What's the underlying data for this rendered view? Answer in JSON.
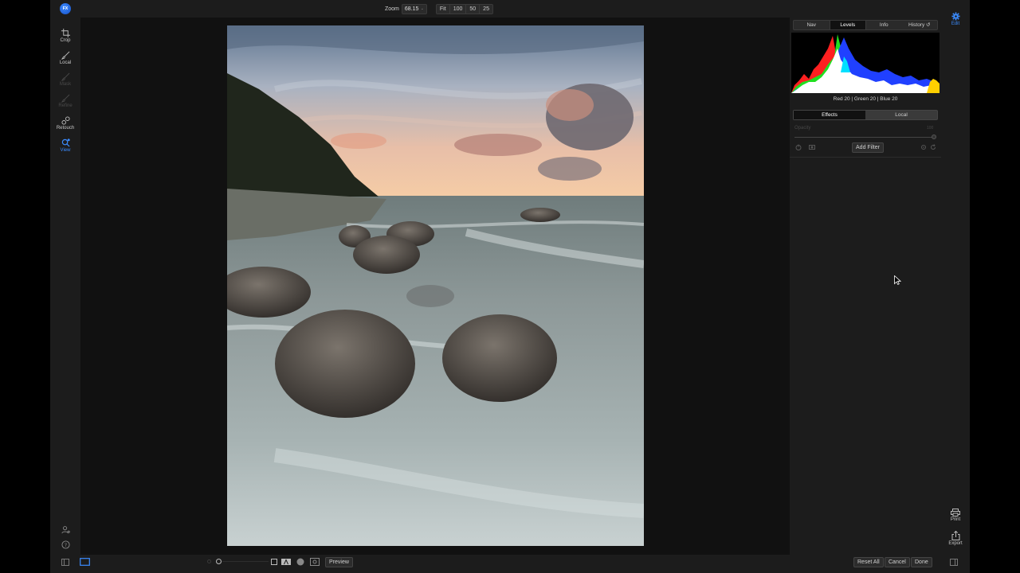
{
  "app": {
    "logo_text": "FX"
  },
  "topbar": {
    "zoom_label": "Zoom",
    "zoom_value": "68.15",
    "zoom_presets": [
      "Fit",
      "100",
      "50",
      "25"
    ]
  },
  "tools": [
    {
      "label": "Crop",
      "icon": "crop-icon",
      "state": "normal"
    },
    {
      "label": "Local",
      "icon": "brush-icon",
      "state": "normal"
    },
    {
      "label": "Mask",
      "icon": "mask-brush-icon",
      "state": "disabled"
    },
    {
      "label": "Refine",
      "icon": "refine-brush-icon",
      "state": "disabled"
    },
    {
      "label": "Retouch",
      "icon": "retouch-icon",
      "state": "normal"
    },
    {
      "label": "View",
      "icon": "magnifier-icon",
      "state": "active"
    }
  ],
  "panel": {
    "tabs": [
      {
        "label": "Nav",
        "active": false
      },
      {
        "label": "Levels",
        "active": true
      },
      {
        "label": "Info",
        "active": false
      },
      {
        "label": "History",
        "active": false
      }
    ],
    "histogram_readout": "Red  20  | Green  20  | Blue  20",
    "layer_tabs": [
      {
        "label": "Effects",
        "active": true
      },
      {
        "label": "Local",
        "active": false
      }
    ],
    "opacity_label": "Opacity",
    "opacity_value": "100",
    "add_filter_label": "Add Filter"
  },
  "rightcol": {
    "edit_label": "Edit",
    "print_label": "Print",
    "export_label": "Export"
  },
  "bottombar": {
    "preview_label": "Preview",
    "reset_all_label": "Reset All",
    "cancel_label": "Cancel",
    "done_label": "Done"
  },
  "colors": {
    "accent": "#3b8cff",
    "panel_bg": "#1c1c1c",
    "canvas_bg": "#111111"
  }
}
